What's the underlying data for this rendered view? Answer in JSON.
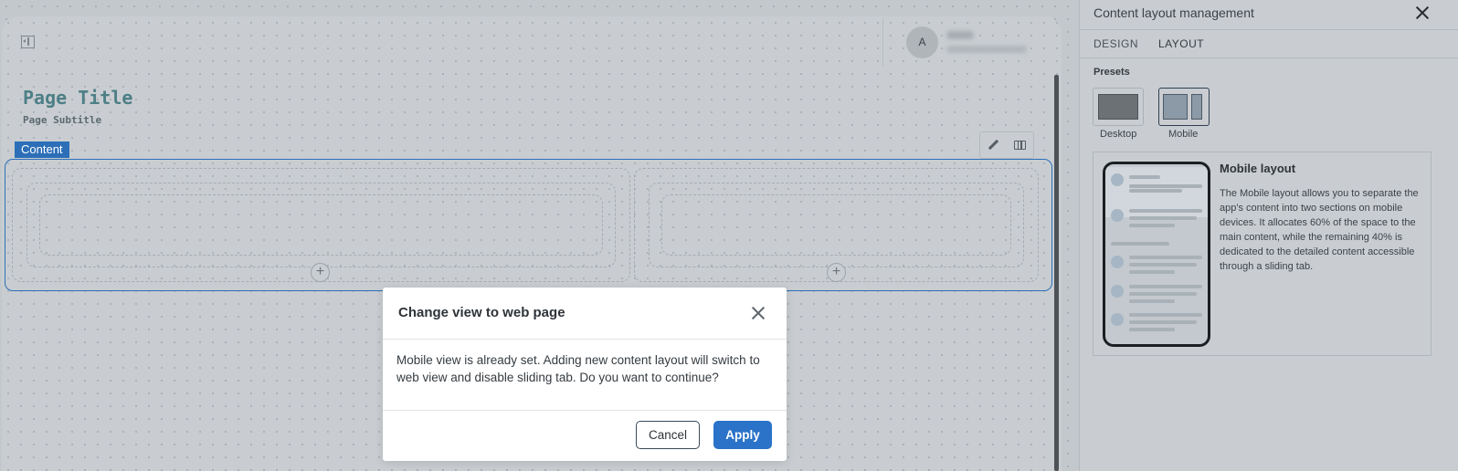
{
  "canvas": {
    "page_title": "Page Title",
    "page_subtitle": "Page Subtitle",
    "content_tag": "Content",
    "avatar_initial": "A"
  },
  "modal": {
    "title": "Change view to web page",
    "body": "Mobile view is already set. Adding new content layout will switch to web view and disable sliding tab. Do you want to continue?",
    "cancel_label": "Cancel",
    "apply_label": "Apply"
  },
  "panel": {
    "title": "Content layout management",
    "tabs": [
      {
        "label": "DESIGN",
        "active": false
      },
      {
        "label": "LAYOUT",
        "active": true
      }
    ],
    "presets_label": "Presets",
    "presets": [
      {
        "label": "Desktop",
        "selected": false
      },
      {
        "label": "Mobile",
        "selected": true
      }
    ],
    "card": {
      "title": "Mobile layout",
      "description": "The Mobile layout allows you to separate the app's content into two sections on mobile devices. It allocates 60% of the space to the main content, while the remaining 40% is dedicated to the detailed content accessible through a sliding tab."
    }
  },
  "icons": [
    "collapse-panel-icon",
    "pencil-icon",
    "columns-icon",
    "plus-icon",
    "close-icon"
  ],
  "colors": {
    "accent": "#2a73c8",
    "content_border": "#2c6fb8",
    "page_title": "#4d7f86"
  }
}
